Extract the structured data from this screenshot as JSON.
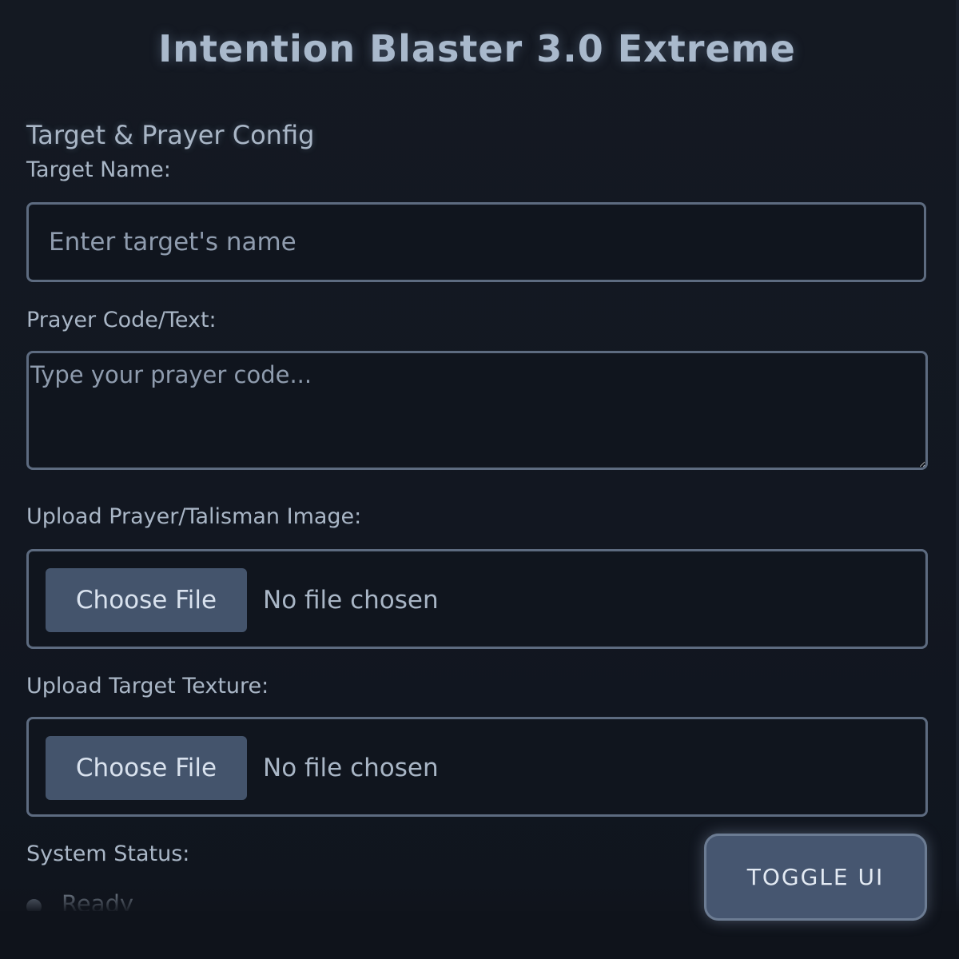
{
  "app": {
    "title": "Intention Blaster 3.0 Extreme"
  },
  "config": {
    "section_title": "Target & Prayer Config",
    "target_name": {
      "label": "Target Name:",
      "value": "",
      "placeholder": "Enter target's name"
    },
    "prayer_code": {
      "label": "Prayer Code/Text:",
      "value": "",
      "placeholder": "Type your prayer code..."
    },
    "prayer_image": {
      "label": "Upload Prayer/Talisman Image:",
      "button_label": "Choose File",
      "status": "No file chosen"
    },
    "target_texture": {
      "label": "Upload Target Texture:",
      "button_label": "Choose File",
      "status": "No file chosen"
    }
  },
  "system": {
    "label": "System Status:",
    "status_text": "Ready",
    "status_color": "#8d9aac"
  },
  "toggle": {
    "label": "TOGGLE UI"
  },
  "colors": {
    "background": "#10141c",
    "accent": "#465670",
    "border": "#5d6b80"
  }
}
